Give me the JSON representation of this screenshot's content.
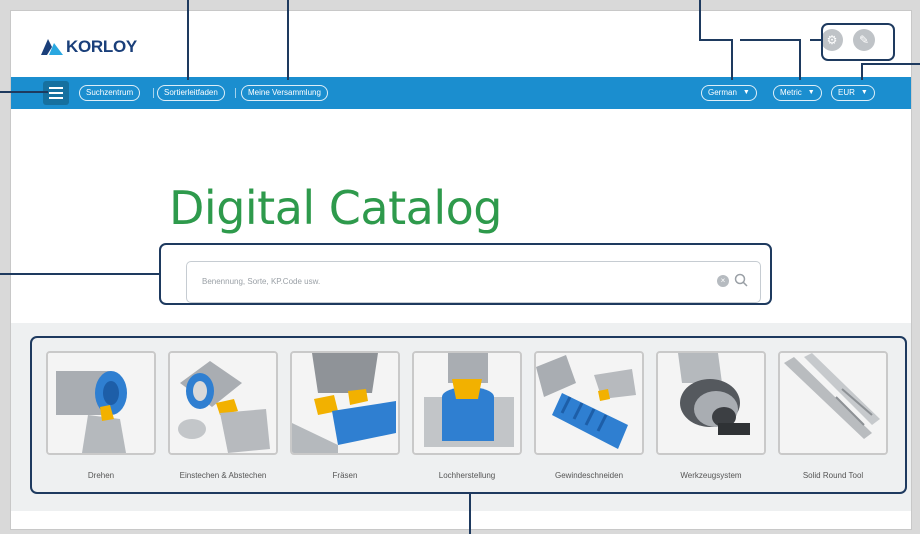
{
  "header": {
    "brand": "KORLOY",
    "icons": [
      "settings-icon",
      "edit-icon"
    ]
  },
  "nav": {
    "menu_icon": "hamburger-icon",
    "links": [
      "Suchzentrum",
      "Sortierleitfaden",
      "Meine Versammlung"
    ],
    "language": "German",
    "unit": "Metric",
    "currency": "EUR"
  },
  "hero": {
    "title": "Digital Catalog",
    "search_placeholder": "Benennung, Sorte, KP.Code usw."
  },
  "categories": [
    {
      "label": "Drehen"
    },
    {
      "label": "Einstechen & Abstechen"
    },
    {
      "label": "Fräsen"
    },
    {
      "label": "Lochherstellung"
    },
    {
      "label": "Gewindeschneiden"
    },
    {
      "label": "Werkzeugsystem"
    },
    {
      "label": "Solid Round Tool"
    }
  ],
  "colors": {
    "nav_blue": "#1b8ecf",
    "title_green": "#2e9a4c",
    "brand_navy": "#1a3f7a",
    "callout": "#1e3a5f",
    "tool_blue": "#2f7fd1",
    "insert_yellow": "#f2b100"
  }
}
